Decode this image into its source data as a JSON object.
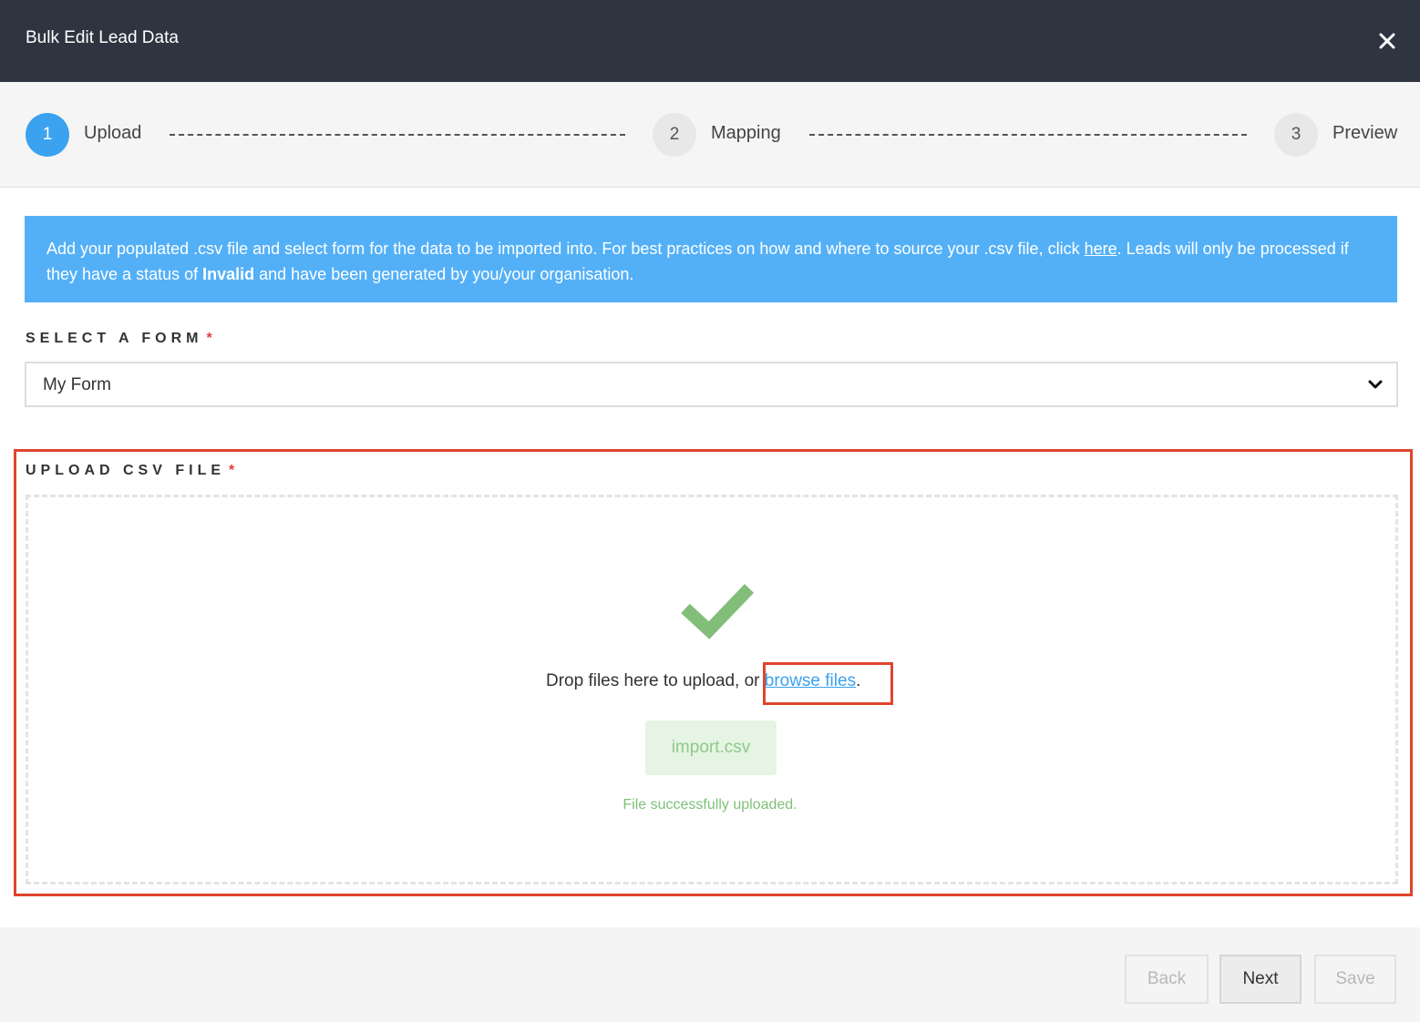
{
  "header": {
    "title": "Bulk Edit Lead Data",
    "close_icon": "close-icon"
  },
  "stepper": {
    "steps": [
      {
        "number": "1",
        "label": "Upload",
        "active": true
      },
      {
        "number": "2",
        "label": "Mapping",
        "active": false
      },
      {
        "number": "3",
        "label": "Preview",
        "active": false
      }
    ]
  },
  "info": {
    "text_part1": "Add your populated .csv file and select form for the data to be imported into. For best practices on how and where to source your .csv file, click ",
    "link_text": "here",
    "text_part2": ". Leads will only be processed if they have a status of ",
    "bold_text": "Invalid",
    "text_part3": " and have been generated by you/your organisation."
  },
  "form_select": {
    "label": "SELECT A FORM",
    "required_mark": "*",
    "value": "My Form"
  },
  "upload": {
    "label": "UPLOAD CSV FILE",
    "required_mark": "*",
    "drop_text": "Drop files here to upload, or ",
    "browse_link": "browse files",
    "drop_text_end": ".",
    "file_name": "import.csv",
    "status": "File successfully uploaded."
  },
  "footer": {
    "back_label": "Back",
    "next_label": "Next",
    "save_label": "Save"
  },
  "colors": {
    "header_bg": "#2e3440",
    "accent": "#3aa2ef",
    "banner": "#53b0f7",
    "success": "#7fc07a",
    "highlight": "#e0452d"
  }
}
